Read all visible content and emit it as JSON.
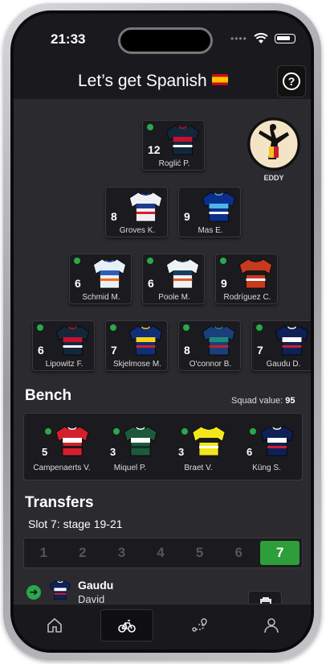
{
  "status": {
    "time": "21:33"
  },
  "header": {
    "title": "Let’s get Spanish",
    "flag_icon": "spain-flag-icon",
    "help_icon": "question-circle-icon"
  },
  "team": {
    "captain": {
      "label": "EDDY"
    },
    "rows": [
      [
        {
          "number": "12",
          "name": "Roglić P.",
          "jersey": "bora",
          "active": true
        }
      ],
      [
        {
          "number": "8",
          "name": "Groves K.",
          "jersey": "alpecin",
          "active": false
        },
        {
          "number": "9",
          "name": "Mas E.",
          "jersey": "movistar",
          "active": false
        }
      ],
      [
        {
          "number": "6",
          "name": "Schmid M.",
          "jersey": "jayco",
          "active": true
        },
        {
          "number": "6",
          "name": "Poole M.",
          "jersey": "picnic",
          "active": true
        },
        {
          "number": "9",
          "name": "Rodríguez C.",
          "jersey": "ineos",
          "active": true
        }
      ],
      [
        {
          "number": "6",
          "name": "Lipowitz F.",
          "jersey": "bora",
          "active": true
        },
        {
          "number": "7",
          "name": "Skjelmose M.",
          "jersey": "lidl",
          "active": true
        },
        {
          "number": "8",
          "name": "O'connor B.",
          "jersey": "decathlon",
          "active": true
        },
        {
          "number": "7",
          "name": "Gaudu D.",
          "jersey": "groupama",
          "active": true
        }
      ]
    ]
  },
  "bench": {
    "title": "Bench",
    "squad_value_label": "Squad value:",
    "squad_value": "95",
    "riders": [
      {
        "number": "5",
        "name": "Campenaerts V.",
        "jersey": "lotto"
      },
      {
        "number": "3",
        "name": "Miquel P.",
        "jersey": "kern"
      },
      {
        "number": "3",
        "name": "Braet V.",
        "jersey": "intermarche"
      },
      {
        "number": "6",
        "name": "Küng S.",
        "jersey": "groupama"
      }
    ]
  },
  "transfers": {
    "title": "Transfers",
    "slot": "Slot 7: stage 19-21",
    "stages": [
      "1",
      "2",
      "3",
      "4",
      "5",
      "6",
      "7"
    ],
    "active_stage": "7",
    "item": {
      "last": "Gaudu",
      "first": "David",
      "jersey": "groupama"
    }
  },
  "tabs": [
    {
      "icon": "home-icon",
      "active": false
    },
    {
      "icon": "bicycle-icon",
      "active": true
    },
    {
      "icon": "route-icon",
      "active": false
    },
    {
      "icon": "user-icon",
      "active": false
    }
  ],
  "colors": {
    "accent": "#2e9e3a",
    "background": "#2b2a2f",
    "card": "#1b1a1e"
  }
}
